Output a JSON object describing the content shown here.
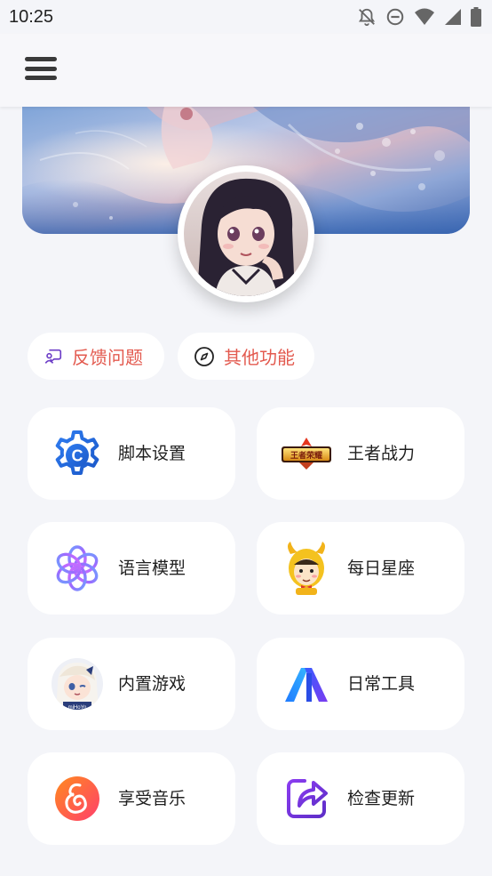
{
  "status_bar": {
    "time": "10:25",
    "icons": [
      "bell-off-icon",
      "do-not-disturb-icon",
      "wifi-icon",
      "cellular-signal-icon",
      "battery-icon"
    ]
  },
  "app_bar": {
    "menu_icon": "hamburger-menu-icon"
  },
  "profile": {
    "banner": "anime-girl-banner-image",
    "avatar": "anime-girl-avatar-image"
  },
  "chips": [
    {
      "label": "反馈问题",
      "icon": "feedback-chat-icon"
    },
    {
      "label": "其他功能",
      "icon": "compass-icon"
    }
  ],
  "menu": {
    "items": [
      {
        "label": "脚本设置",
        "icon": "script-gear-c-icon"
      },
      {
        "label": "王者战力",
        "icon": "honor-of-kings-logo-icon"
      },
      {
        "label": "语言模型",
        "icon": "openai-knot-icon"
      },
      {
        "label": "每日星座",
        "icon": "cartoon-bull-horoscope-icon"
      },
      {
        "label": "内置游戏",
        "icon": "anime-character-game-icon"
      },
      {
        "label": "日常工具",
        "icon": "gradient-a-tools-icon"
      },
      {
        "label": "享受音乐",
        "icon": "netease-music-icon"
      },
      {
        "label": "检查更新",
        "icon": "share-update-arrow-icon"
      }
    ]
  },
  "colors": {
    "page_background": "#f4f5f9",
    "chip_text": "#e35a4f",
    "card_background": "#ffffff"
  }
}
